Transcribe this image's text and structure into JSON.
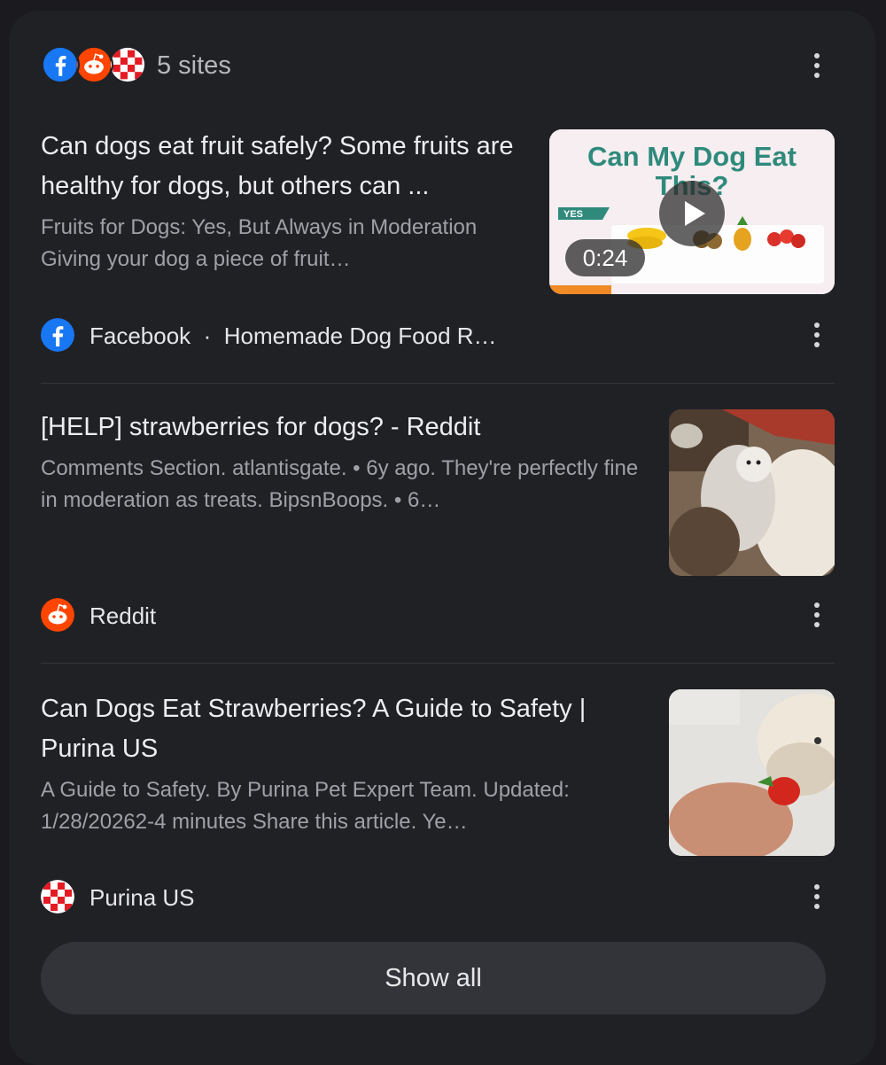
{
  "header": {
    "sites_count": "5 sites",
    "favicons": [
      "facebook-icon",
      "reddit-icon",
      "purina-icon"
    ]
  },
  "results": [
    {
      "title": "Can dogs eat fruit safely? Some fruits are healthy for dogs, but others can ...",
      "snippet": "Fruits for Dogs: Yes, But Always in Moderation Giving your dog a piece of fruit…",
      "thumbnail": {
        "type": "video",
        "heading": "Can My Dog Eat This?",
        "badge": "YES",
        "duration": "0:24"
      },
      "source": "Facebook",
      "source_sub": "Homemade Dog Food R…",
      "icon": "facebook-icon"
    },
    {
      "title": "[HELP] strawberries for dogs? - Reddit",
      "snippet": "Comments Section. atlantisgate. • 6y ago. They're perfectly fine in moderation as treats. BipsnBoops. • 6…",
      "source": "Reddit",
      "icon": "reddit-icon"
    },
    {
      "title": "Can Dogs Eat Strawberries? A Guide to Safety | Purina US",
      "snippet": "A Guide to Safety. By Purina Pet Expert Team. Updated: 1/28/20262-4 minutes Share this article. Ye…",
      "source": "Purina US",
      "icon": "purina-icon"
    }
  ],
  "show_all": "Show all",
  "colors": {
    "background": "#1b1b1f",
    "card": "#202125",
    "facebook": "#1877f2",
    "reddit": "#ff4500",
    "purina": "#e41b23"
  }
}
